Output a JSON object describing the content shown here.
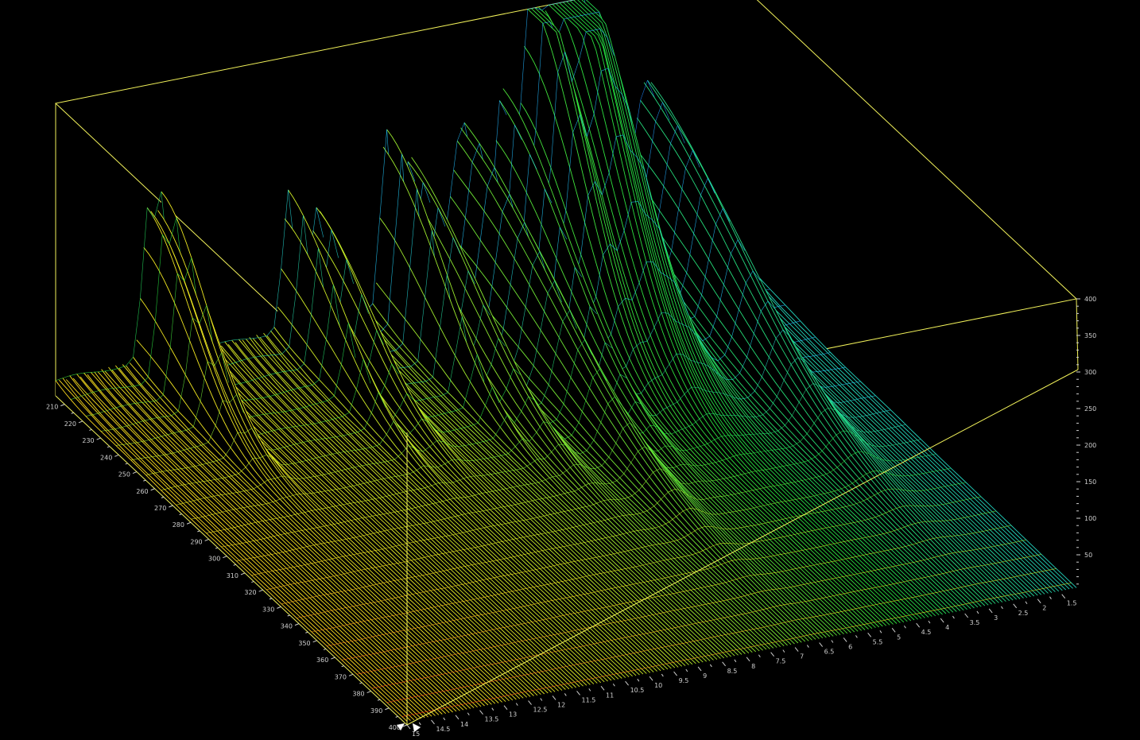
{
  "chart_data": {
    "type": "surface-3d-wireframe",
    "title": "",
    "wavelength_axis": {
      "label": "",
      "ticks": [
        "210",
        "220",
        "230",
        "240",
        "250",
        "260",
        "270",
        "280",
        "290",
        "300",
        "310",
        "320",
        "330",
        "340",
        "350",
        "360",
        "370",
        "380",
        "390",
        "400"
      ],
      "range": [
        205,
        400
      ]
    },
    "time_axis": {
      "label": "",
      "ticks": [
        "1.5",
        "2",
        "2.5",
        "3",
        "3.5",
        "4",
        "4.5",
        "5",
        "5.5",
        "6",
        "6.5",
        "7",
        "7.5",
        "8",
        "8.5",
        "9",
        "9.5",
        "10",
        "10.5",
        "11",
        "11.5",
        "12",
        "12.5",
        "13",
        "13.5",
        "14",
        "14.5",
        "15"
      ],
      "range": [
        1.2,
        15
      ]
    },
    "intensity_axis": {
      "label": "",
      "ticks": [
        "50",
        "100",
        "150",
        "200",
        "250",
        "300",
        "350",
        "400"
      ],
      "range": [
        0,
        400
      ]
    },
    "colormap": [
      "#0a1eff",
      "#22a8ff",
      "#22d0ff",
      "#26e040",
      "#c8f028",
      "#ffe41e",
      "#ff8a1a",
      "#ff1a12"
    ],
    "frame_color": "#f2f25a",
    "background": "#000000",
    "peaks": [
      {
        "time": 13.1,
        "height": 200,
        "wavelength_width": 26,
        "time_width": 0.12
      },
      {
        "time": 12.8,
        "height": 215,
        "wavelength_width": 26,
        "time_width": 0.12
      },
      {
        "time": 10.2,
        "height": 190,
        "wavelength_width": 30,
        "time_width": 0.12
      },
      {
        "time": 9.6,
        "height": 160,
        "wavelength_width": 30,
        "time_width": 0.15
      },
      {
        "time": 8.2,
        "height": 245,
        "wavelength_width": 32,
        "time_width": 0.1
      },
      {
        "time": 7.7,
        "height": 200,
        "wavelength_width": 40,
        "time_width": 0.18
      },
      {
        "time": 6.6,
        "height": 230,
        "wavelength_width": 55,
        "time_width": 0.25
      },
      {
        "time": 5.8,
        "height": 260,
        "wavelength_width": 38,
        "time_width": 0.15
      },
      {
        "time": 5.2,
        "height": 400,
        "wavelength_width": 30,
        "time_width": 0.2
      },
      {
        "time": 4.7,
        "height": 290,
        "wavelength_width": 35,
        "time_width": 0.2
      },
      {
        "time": 4.2,
        "height": 400,
        "wavelength_width": 32,
        "time_width": 0.35
      },
      {
        "time": 2.8,
        "height": 235,
        "wavelength_width": 55,
        "time_width": 0.3
      }
    ]
  }
}
